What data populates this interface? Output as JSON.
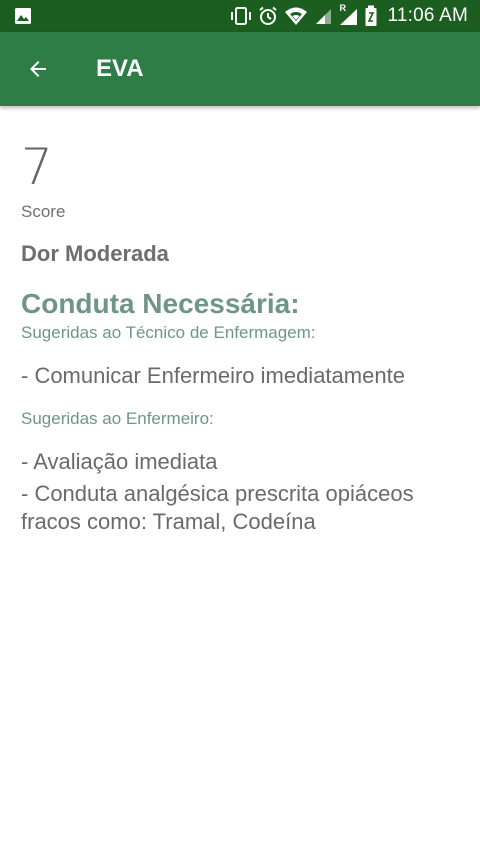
{
  "status_bar": {
    "time": "11:06 AM",
    "icons": [
      "image-icon",
      "vibrate-icon",
      "alarm-icon",
      "wifi-icon",
      "signal-icon",
      "roaming-signal-icon",
      "battery-icon"
    ],
    "roaming_label": "R"
  },
  "app_bar": {
    "title": "EVA",
    "back_icon": "arrow-left-icon",
    "color": "#2e7d46"
  },
  "result": {
    "score_value": "7",
    "score_label": "Score",
    "pain_level": "Dor Moderada"
  },
  "conduct": {
    "title": "Conduta Necessária:",
    "technician_label": "Sugeridas ao Técnico de Enfermagem:",
    "technician_items": [
      "- Comunicar Enfermeiro imediatamente"
    ],
    "nurse_label": "Sugeridas ao Enfermeiro:",
    "nurse_items": [
      "- Avaliação imediata",
      "- Conduta analgésica prescrita opiáceos fracos como: Tramal, Codeína"
    ]
  },
  "colors": {
    "status_bar": "#1b5e20",
    "accent_text": "#6f958b"
  }
}
